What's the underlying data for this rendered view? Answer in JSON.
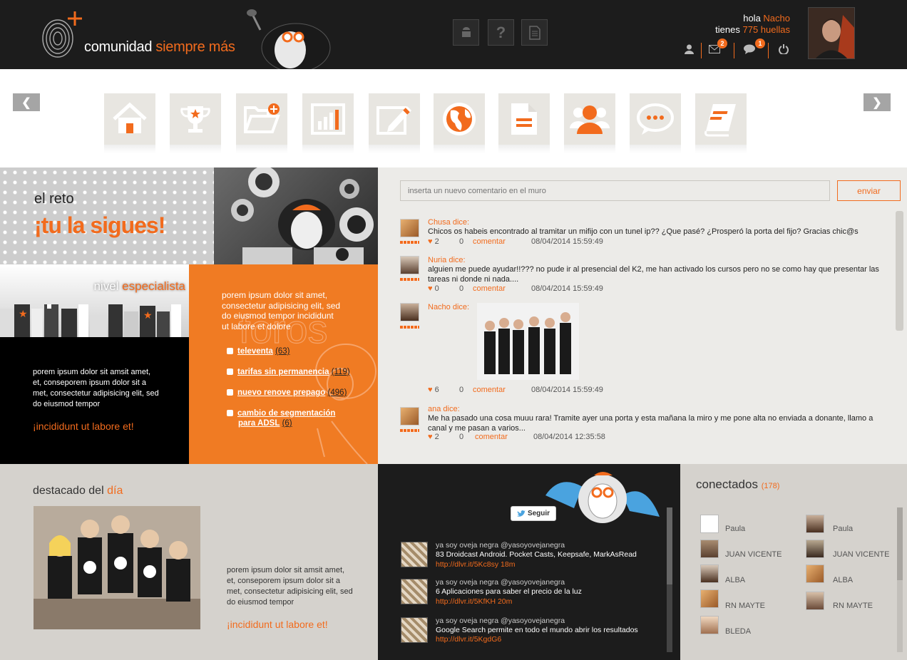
{
  "header": {
    "logo_text_1": "comunidad",
    "logo_text_2": "siempre más",
    "greeting_hola": "hola",
    "greeting_name": "Nacho",
    "greeting_tienes": "tienes",
    "greeting_points": "775 huellas",
    "messages_badge": "2",
    "comments_badge": "1",
    "tools": [
      "android-icon",
      "help-icon",
      "document-icon"
    ]
  },
  "nav": {
    "items": [
      "home-icon",
      "trophy-icon",
      "folder-add-icon",
      "chart-icon",
      "edit-icon",
      "globe-icon",
      "document-icon",
      "users-icon",
      "chat-icon",
      "book-icon"
    ]
  },
  "hero": {
    "line1": "el reto",
    "line2": "¡tu la sigues!"
  },
  "nivel": {
    "label": "nivel",
    "value": "especialista",
    "text": "porem ipsum dolor sit amsit amet, et, conseporem ipsum dolor sit a met, consectetur adipisicing elit, sed do eiusmod tempor",
    "cta": "¡incididunt ut labore et!"
  },
  "orange": {
    "text": "porem ipsum dolor sit amet, consectetur adipisicing elit, sed do eiusmod tempor incididunt ut labore et dolore",
    "links": [
      {
        "label": "televenta",
        "count": "(63)"
      },
      {
        "label": "tarifas sin permanencia",
        "count": "(119)"
      },
      {
        "label": "nuevo renove prepago",
        "count": "(496)"
      },
      {
        "label": "cambio de segmentación",
        "label2": "para ADSL",
        "count": "(6)"
      }
    ]
  },
  "wall": {
    "placeholder": "inserta un nuevo comentario en el muro",
    "send": "enviar",
    "posts": [
      {
        "author": "Chusa dice:",
        "text": "Chicos os habeis encontrado al tramitar un mifijo con un tunel ip?? ¿Que pasé? ¿Prosperó la porta del fijo? Gracias chic@s",
        "likes": "2",
        "comments": "0",
        "comment_label": "comentar",
        "date": "08/04/2014 15:59:49"
      },
      {
        "author": "Nuria dice:",
        "text": "alguien me puede ayudar!!??? no pude ir al presencial del K2, me han activado los cursos pero no se como hay que presentar las tareas ni donde ni nada....",
        "likes": "0",
        "comments": "0",
        "comment_label": "comentar",
        "date": "08/04/2014 15:59:49"
      },
      {
        "author": "Nacho dice:",
        "text": "",
        "likes": "6",
        "comments": "0",
        "comment_label": "comentar",
        "date": "08/04/2014 15:59:49"
      },
      {
        "author": "ana dice:",
        "text": "Me ha pasado una cosa muuu rara! Tramite ayer una porta y esta mañana la miro y me pone alta no enviada a donante, llamo a canal y me pasan a varios...",
        "likes": "2",
        "comments": "0",
        "comment_label": "comentar",
        "date": "08/04/2014 12:35:58"
      }
    ]
  },
  "destacado": {
    "title_1": "destacado del",
    "title_2": "día",
    "text": "porem ipsum dolor sit amsit amet, et, conseporem ipsum dolor sit a met, consectetur adipisicing elit, sed do eiusmod tempor",
    "cta": "¡incididunt ut labore et!"
  },
  "twitter": {
    "follow": "Seguir",
    "tweets": [
      {
        "user": "ya soy oveja negra @yasoyovejanegra",
        "text": "83 Droidcast Android. Pocket Casts, Keepsafe, MarkAsRead",
        "link": "http://dlvr.it/5Kc8sy 18m"
      },
      {
        "user": "ya soy oveja negra @yasoyovejanegra",
        "text": "6 Aplicaciones para saber el precio de la luz",
        "link": "http://dlvr.it/5KfKH 20m"
      },
      {
        "user": "ya soy oveja negra @yasoyovejanegra",
        "text": "Google Search permite en todo el mundo abrir los resultados",
        "link": "http://dlvr.it/5KgdG6"
      }
    ]
  },
  "conectados": {
    "title": "conectados",
    "count": "(178)",
    "col1": [
      "Paula",
      "JUAN VICENTE",
      "ALBA",
      "RN MAYTE",
      "BLEDA"
    ],
    "col2": [
      "Paula",
      "JUAN VICENTE",
      "ALBA",
      "RN MAYTE"
    ]
  },
  "colors": {
    "accent": "#f26b1d",
    "dark": "#1c1c1c",
    "panel": "#d5d2cd"
  }
}
